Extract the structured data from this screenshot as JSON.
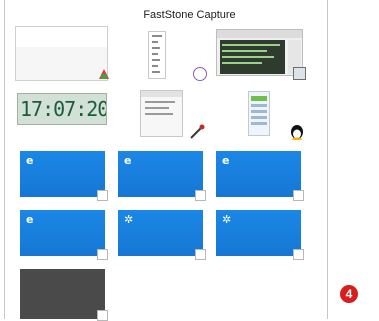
{
  "window": {
    "title": "FastStone Capture"
  },
  "icons": {
    "row1": [
      "blank-thumbnail",
      "document-thumbnail",
      "circle-icon",
      "terminal-thumbnail"
    ],
    "row2": [
      "clock-thumbnail",
      "dialog-thumbnail",
      "pen-icon",
      "chat-thumbnail",
      "penguin-icon"
    ],
    "row3": [
      "ie-tile",
      "ie-tile",
      "ie-tile"
    ],
    "row4": [
      "ie-tile",
      "settings-tile",
      "settings-tile"
    ],
    "row5": [
      "dark-tile"
    ]
  },
  "clock": {
    "text": "17:07:20"
  },
  "tiles": {
    "ie_glyph": "e",
    "settings_glyph": "✲"
  },
  "badge": {
    "number": "4"
  },
  "colors": {
    "tile_blue": "#1b87e6",
    "badge_red": "#d81d1d",
    "dark_tile": "#4a4a4a"
  }
}
